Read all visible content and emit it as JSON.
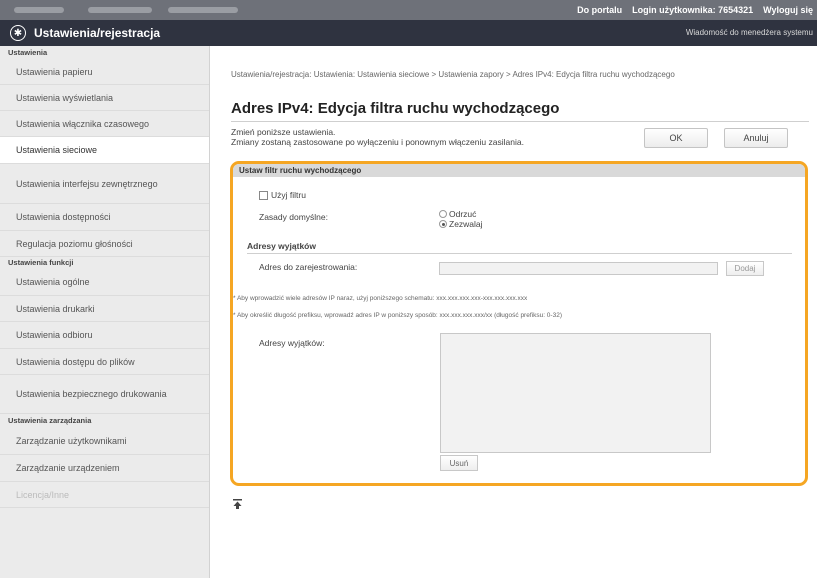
{
  "topbar": {
    "portal_link": "Do portalu",
    "login_label": "Login użytkownika:",
    "login_id": "7654321",
    "logout_link": "Wyloguj się"
  },
  "titlebar": {
    "title": "Ustawienia/rejestracja",
    "admin_message": "Wiadomość do menedżera systemu"
  },
  "sidebar": {
    "group1": "Ustawienia",
    "group1_items": [
      "Ustawienia papieru",
      "Ustawienia wyświetlania",
      "Ustawienia włącznika czasowego",
      "Ustawienia sieciowe",
      "Ustawienia interfejsu zewnętrznego",
      "Ustawienia dostępności",
      "Regulacja poziomu głośności"
    ],
    "group2": "Ustawienia funkcji",
    "group2_items": [
      "Ustawienia ogólne",
      "Ustawienia drukarki",
      "Ustawienia odbioru",
      "Ustawienia dostępu do plików",
      "Ustawienia bezpiecznego drukowania"
    ],
    "group3": "Ustawienia zarządzania",
    "group3_items": [
      "Zarządzanie użytkownikami",
      "Zarządzanie urządzeniem",
      "Licencja/Inne"
    ]
  },
  "main": {
    "breadcrumb": "Ustawienia/rejestracja: Ustawienia: Ustawienia sieciowe > Ustawienia zapory > Adres IPv4: Edycja filtra ruchu wychodzącego",
    "page_title": "Adres IPv4: Edycja filtra ruchu wychodzącego",
    "intro_line1": "Zmień poniższe ustawienia.",
    "intro_line2": "Zmiany zostaną zastosowane po wyłączeniu i ponownym włączeniu zasilania.",
    "ok_label": "OK",
    "cancel_label": "Anuluj",
    "panel": {
      "header": "Ustaw filtr ruchu wychodzącego",
      "use_filter_label": "Użyj filtru",
      "use_filter_checked": false,
      "default_policy_label": "Zasady domyślne:",
      "radio_reject": "Odrzuć",
      "radio_allow": "Zezwalaj",
      "selected_policy": "Zezwalaj",
      "exceptions_section": "Adresy wyjątków",
      "register_label": "Adres do zarejestrowania:",
      "register_value": "",
      "add_label": "Dodaj",
      "note1": "* Aby wprowadzić wiele adresów IP naraz, użyj poniższego schematu: xxx.xxx.xxx.xxx-xxx.xxx.xxx.xxx",
      "note2": "* Aby określić długość prefiksu, wprowadź adres IP w poniższy sposób: xxx.xxx.xxx.xxx/xx (długość prefiksu: 0-32)",
      "exceptions_label": "Adresy wyjątków:",
      "exceptions_list": [],
      "delete_label": "Usuń"
    }
  },
  "colors": {
    "highlight": "#f5a623",
    "titlebar": "#2f3340",
    "topbar": "#6e7179"
  }
}
